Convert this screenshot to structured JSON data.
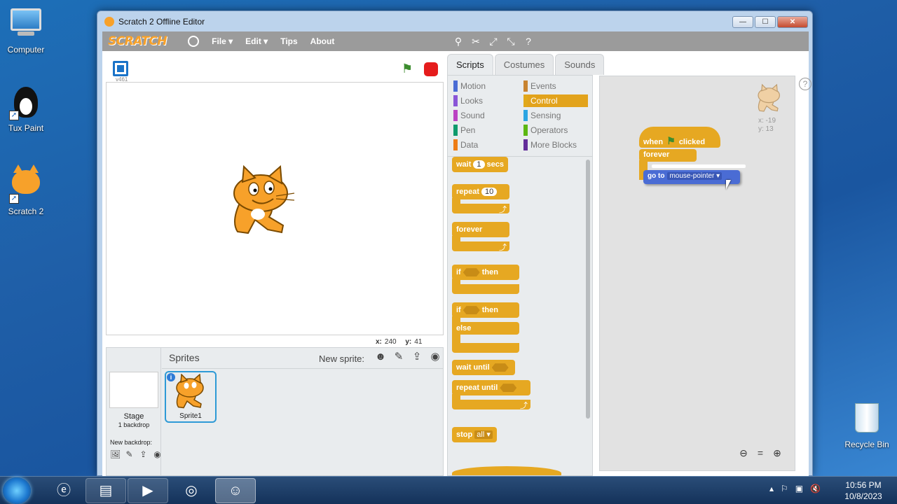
{
  "desktop": {
    "icons": [
      {
        "label": "Computer"
      },
      {
        "label": "Tux Paint"
      },
      {
        "label": "Scratch 2"
      },
      {
        "label": "Recycle Bin"
      }
    ]
  },
  "window": {
    "title": "Scratch 2 Offline Editor",
    "controls": {
      "minimize": "—",
      "maximize": "☐",
      "close": "✕"
    }
  },
  "menubar": {
    "logo": "SCRATCH",
    "items": [
      "File ▾",
      "Edit ▾",
      "Tips",
      "About"
    ]
  },
  "stage": {
    "version": "v461",
    "coords": {
      "x_label": "x:",
      "x_value": "240",
      "y_label": "y:",
      "y_value": "41"
    }
  },
  "sprites": {
    "title": "Sprites",
    "new_sprite_label": "New sprite:",
    "stage_label": "Stage",
    "backdrop_count": "1 backdrop",
    "new_backdrop_label": "New backdrop:",
    "items": [
      {
        "name": "Sprite1",
        "info": "i"
      }
    ]
  },
  "tabs": [
    "Scripts",
    "Costumes",
    "Sounds"
  ],
  "categories": [
    {
      "label": "Motion",
      "color": "#4a6cd4"
    },
    {
      "label": "Events",
      "color": "#c88330"
    },
    {
      "label": "Looks",
      "color": "#8a55d7"
    },
    {
      "label": "Control",
      "color": "#e1a91a"
    },
    {
      "label": "Sound",
      "color": "#bb42c3"
    },
    {
      "label": "Sensing",
      "color": "#2ca5e2"
    },
    {
      "label": "Pen",
      "color": "#0e9a6c"
    },
    {
      "label": "Operators",
      "color": "#5cb712"
    },
    {
      "label": "Data",
      "color": "#ee7d16"
    },
    {
      "label": "More Blocks",
      "color": "#632d99"
    }
  ],
  "palette_blocks": {
    "wait": {
      "label": "wait",
      "value": "1",
      "unit": "secs"
    },
    "repeat": {
      "label": "repeat",
      "value": "10"
    },
    "forever": {
      "label": "forever"
    },
    "if_then": {
      "if": "if",
      "then": "then"
    },
    "if_else": {
      "if": "if",
      "then": "then",
      "else": "else"
    },
    "wait_until": {
      "label": "wait until"
    },
    "repeat_until": {
      "label": "repeat until"
    },
    "stop": {
      "label": "stop",
      "option": "all ▾"
    }
  },
  "script": {
    "hat_when": "when",
    "hat_clicked": "clicked",
    "forever": "forever",
    "goto_label": "go to",
    "goto_target": "mouse-pointer ▾",
    "sprite_x": "x: -19",
    "sprite_y": "y: 13"
  },
  "taskbar": {
    "time": "10:56 PM",
    "date": "10/8/2023"
  }
}
